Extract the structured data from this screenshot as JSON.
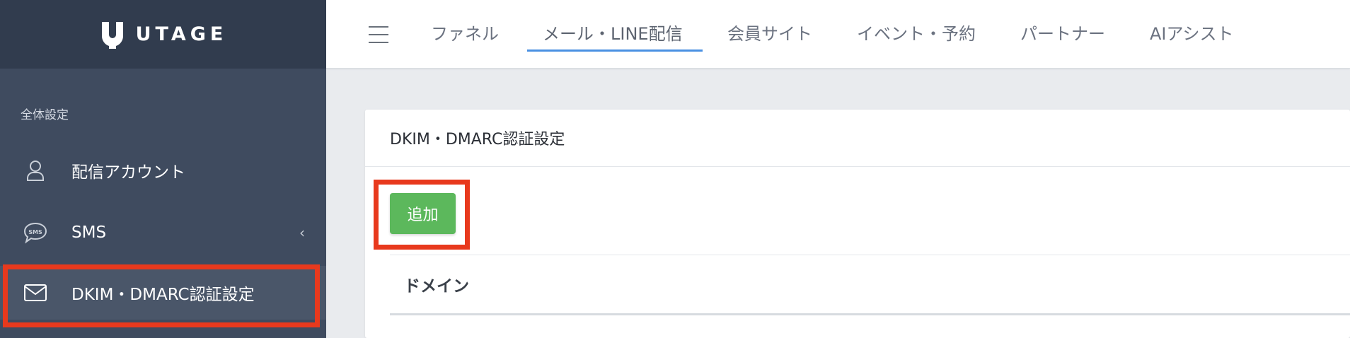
{
  "brand": {
    "name": "UTAGE",
    "logo_icon": "utage-logo-icon"
  },
  "sidebar": {
    "section_label": "全体設定",
    "items": [
      {
        "label": "配信アカウント",
        "icon": "user-icon"
      },
      {
        "label": "SMS",
        "icon": "sms-bubble-icon",
        "chevron": "‹"
      },
      {
        "label": "DKIM・DMARC認証設定",
        "icon": "envelope-icon",
        "active": true
      }
    ]
  },
  "topnav": {
    "menu_icon": "hamburger-icon",
    "tabs": [
      {
        "label": "ファネル"
      },
      {
        "label": "メール・LINE配信",
        "active": true
      },
      {
        "label": "会員サイト"
      },
      {
        "label": "イベント・予約"
      },
      {
        "label": "パートナー"
      },
      {
        "label": "AIアシスト"
      }
    ]
  },
  "card": {
    "title": "DKIM・DMARC認証設定",
    "add_button": "追加",
    "table": {
      "columns": [
        "ドメイン"
      ]
    }
  },
  "colors": {
    "sidebar_bg": "#3f4b5f",
    "brand_bg": "#313c4e",
    "active_item_bg": "#4a5669",
    "accent_blue": "#4a90e2",
    "button_green": "#5cb85c",
    "highlight_red": "#e8391d"
  }
}
